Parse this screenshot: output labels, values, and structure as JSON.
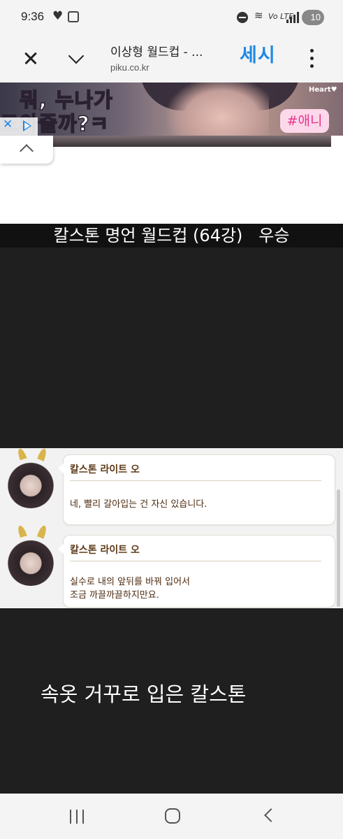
{
  "status_bar": {
    "time": "9:36",
    "battery": "10",
    "network": "Vo LTE"
  },
  "browser": {
    "page_title": "이상형 월드컵 - ...",
    "host": "piku.co.kr",
    "translate_label": "세시"
  },
  "ad": {
    "line1_pre": "뭐, ",
    "line1_highlight": "누나",
    "line1_post": "가",
    "line2": "도와줄까?ㅋ",
    "tag": "#애니",
    "logo": "Heart♥"
  },
  "video": {
    "title": "칼스톤 명언 월드컵 (64강)   우승",
    "caption": "속옷 거꾸로 입은 칼스톤"
  },
  "dialogs": [
    {
      "speaker": "칼스톤 라이트 오",
      "lines": [
        "네, 빨리 갈아입는 건 자신 있습니다."
      ]
    },
    {
      "speaker": "칼스톤 라이트 오",
      "lines": [
        "실수로 내의 앞뒤를 바꿔 입어서",
        "조금 까끌까끌하지만요."
      ]
    }
  ],
  "icons": {
    "close": "close-icon",
    "expand": "chevron-down-icon",
    "more": "more-vert-icon",
    "collapse": "chevron-up-icon",
    "nav_recent": "recent-apps-icon",
    "nav_home": "home-icon",
    "nav_back": "back-icon"
  },
  "colors": {
    "accent": "#1e88e5",
    "ad_pink": "#f13ba0",
    "video_bg": "#1f1f1f",
    "dialog_text": "#4d2b10"
  }
}
